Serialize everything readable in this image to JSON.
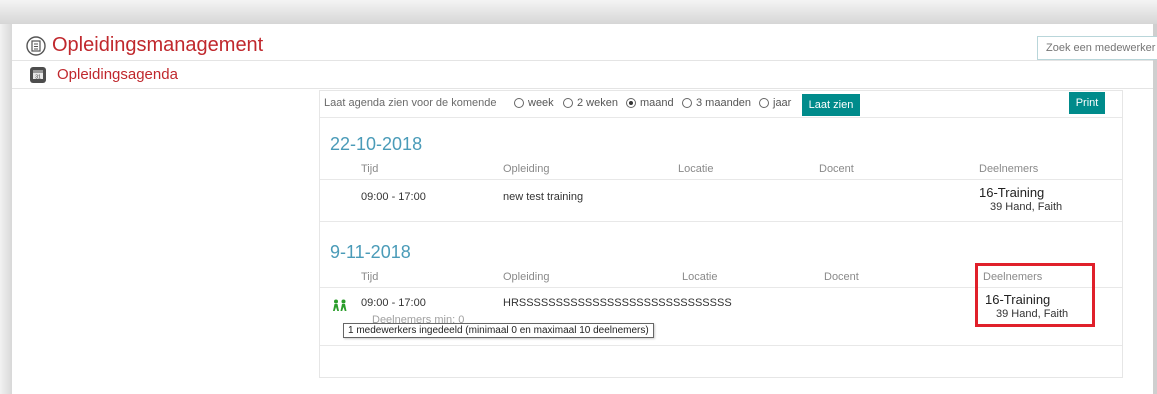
{
  "header": {
    "title": "Opleidingsmanagement",
    "search_placeholder": "Zoek een medewerker"
  },
  "subheader": {
    "title": "Opleidingsagenda"
  },
  "filter": {
    "label": "Laat agenda zien voor de komende",
    "options": [
      "week",
      "2 weken",
      "maand",
      "3 maanden",
      "jaar"
    ],
    "selected": "maand",
    "show_button": "Laat zien",
    "print_button": "Print"
  },
  "columns": {
    "time": "Tijd",
    "training": "Opleiding",
    "location": "Locatie",
    "teacher": "Docent",
    "participants": "Deelnemers"
  },
  "sessions": [
    {
      "date": "22-10-2018",
      "time": "09:00 - 17:00",
      "training": "new test training",
      "group": "16-Training",
      "member": "39 Hand, Faith"
    },
    {
      "date": "9-11-2018",
      "time": "09:00 - 17:00",
      "training": "HRSSSSSSSSSSSSSSSSSSSSSSSSSSSSS",
      "participants_min": "Deelnemers min: 0",
      "group": "16-Training",
      "member": "39 Hand, Faith",
      "tooltip": "1 medewerkers ingedeeld (minimaal 0 en maximaal 10 deelnemers)"
    }
  ],
  "colors": {
    "title_red": "#c0282d",
    "teal": "#008b8b",
    "date_blue": "#4a9bb8",
    "highlight_red": "#e0202a",
    "people_green": "#2a9d2a"
  },
  "icons": {
    "header": "document-icon",
    "subheader": "calendar-book-icon",
    "session": "people-icon"
  }
}
